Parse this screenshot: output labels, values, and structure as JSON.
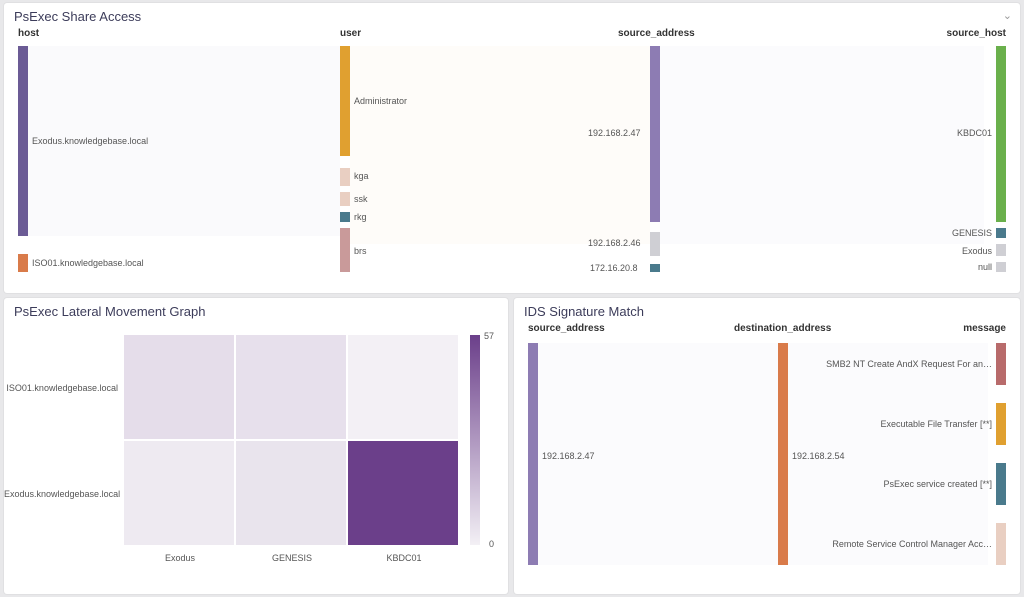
{
  "panel1": {
    "title": "PsExec Share Access",
    "columns": [
      "host",
      "user",
      "source_address",
      "source_host"
    ],
    "nodes": {
      "host": [
        {
          "label": "Exodus.knowledgebase.local",
          "weight": 0.85,
          "color": "#6b5b95"
        },
        {
          "label": "ISO01.knowledgebase.local",
          "weight": 0.07,
          "color": "#d97b4a"
        }
      ],
      "user": [
        {
          "label": "Administrator",
          "weight": 0.5,
          "color": "#e0a030"
        },
        {
          "label": "kga",
          "weight": 0.09,
          "color": "#e9cfc2"
        },
        {
          "label": "ssk",
          "weight": 0.07,
          "color": "#e9cfc2"
        },
        {
          "label": "rkg",
          "weight": 0.04,
          "color": "#4a7a8c"
        },
        {
          "label": "brs",
          "weight": 0.2,
          "color": "#c99a9a"
        }
      ],
      "source_address": [
        {
          "label": "192.168.2.47",
          "weight": 0.78,
          "color": "#8d7cb3"
        },
        {
          "label": "192.168.2.46",
          "weight": 0.1,
          "color": "#cfcfd4"
        },
        {
          "label": "172.16.20.8",
          "weight": 0.03,
          "color": "#4a7a8c"
        }
      ],
      "source_host": [
        {
          "label": "KBDC01",
          "weight": 0.78,
          "color": "#6ab04c"
        },
        {
          "label": "GENESIS",
          "weight": 0.04,
          "color": "#4a7a8c"
        },
        {
          "label": "Exodus",
          "weight": 0.05,
          "color": "#cfcfd4"
        },
        {
          "label": "null",
          "weight": 0.04,
          "color": "#cfcfd4"
        }
      ]
    }
  },
  "panel2": {
    "title": "PsExec Lateral Movement Graph",
    "legend_max": "57",
    "legend_min": "0",
    "x": [
      "Exodus",
      "GENESIS",
      "KBDC01"
    ],
    "y": [
      "ISO01.knowledgebase.local",
      "Exodus.knowledgebase.local"
    ],
    "grid": [
      [
        6,
        5,
        0
      ],
      [
        2,
        4,
        57
      ]
    ]
  },
  "panel3": {
    "title": "IDS Signature Match",
    "columns": [
      "source_address",
      "destination_address",
      "message"
    ],
    "source": {
      "label": "192.168.2.47",
      "color": "#8d7cb3"
    },
    "dest": {
      "label": "192.168.2.54",
      "color": "#d97b4a"
    },
    "messages": [
      {
        "label": "SMB2 NT Create AndX Request For an…",
        "weight": 0.14,
        "color": "#b86b6b"
      },
      {
        "label": "Executable File Transfer [**]",
        "weight": 0.14,
        "color": "#e0a030"
      },
      {
        "label": "PsExec service created [**]",
        "weight": 0.14,
        "color": "#4a7a8c"
      },
      {
        "label": "Remote Service Control Manager Acc…",
        "weight": 0.14,
        "color": "#e9cfc2"
      }
    ]
  },
  "chart_data": [
    {
      "type": "sankey",
      "title": "PsExec Share Access",
      "stages": [
        "host",
        "user",
        "source_address",
        "source_host"
      ],
      "nodes": {
        "host": [
          "Exodus.knowledgebase.local",
          "ISO01.knowledgebase.local"
        ],
        "user": [
          "Administrator",
          "kga",
          "ssk",
          "rkg",
          "brs"
        ],
        "source_address": [
          "192.168.2.47",
          "192.168.2.46",
          "172.16.20.8"
        ],
        "source_host": [
          "KBDC01",
          "GENESIS",
          "Exodus",
          "null"
        ]
      }
    },
    {
      "type": "heatmap",
      "title": "PsExec Lateral Movement Graph",
      "x": [
        "Exodus",
        "GENESIS",
        "KBDC01"
      ],
      "y": [
        "ISO01.knowledgebase.local",
        "Exodus.knowledgebase.local"
      ],
      "values": [
        [
          6,
          5,
          0
        ],
        [
          2,
          4,
          57
        ]
      ],
      "color_range": [
        0,
        57
      ]
    },
    {
      "type": "sankey",
      "title": "IDS Signature Match",
      "stages": [
        "source_address",
        "destination_address",
        "message"
      ],
      "nodes": {
        "source_address": [
          "192.168.2.47"
        ],
        "destination_address": [
          "192.168.2.54"
        ],
        "message": [
          "SMB2 NT Create AndX Request For an…",
          "Executable File Transfer [**]",
          "PsExec service created [**]",
          "Remote Service Control Manager Acc…"
        ]
      }
    }
  ]
}
